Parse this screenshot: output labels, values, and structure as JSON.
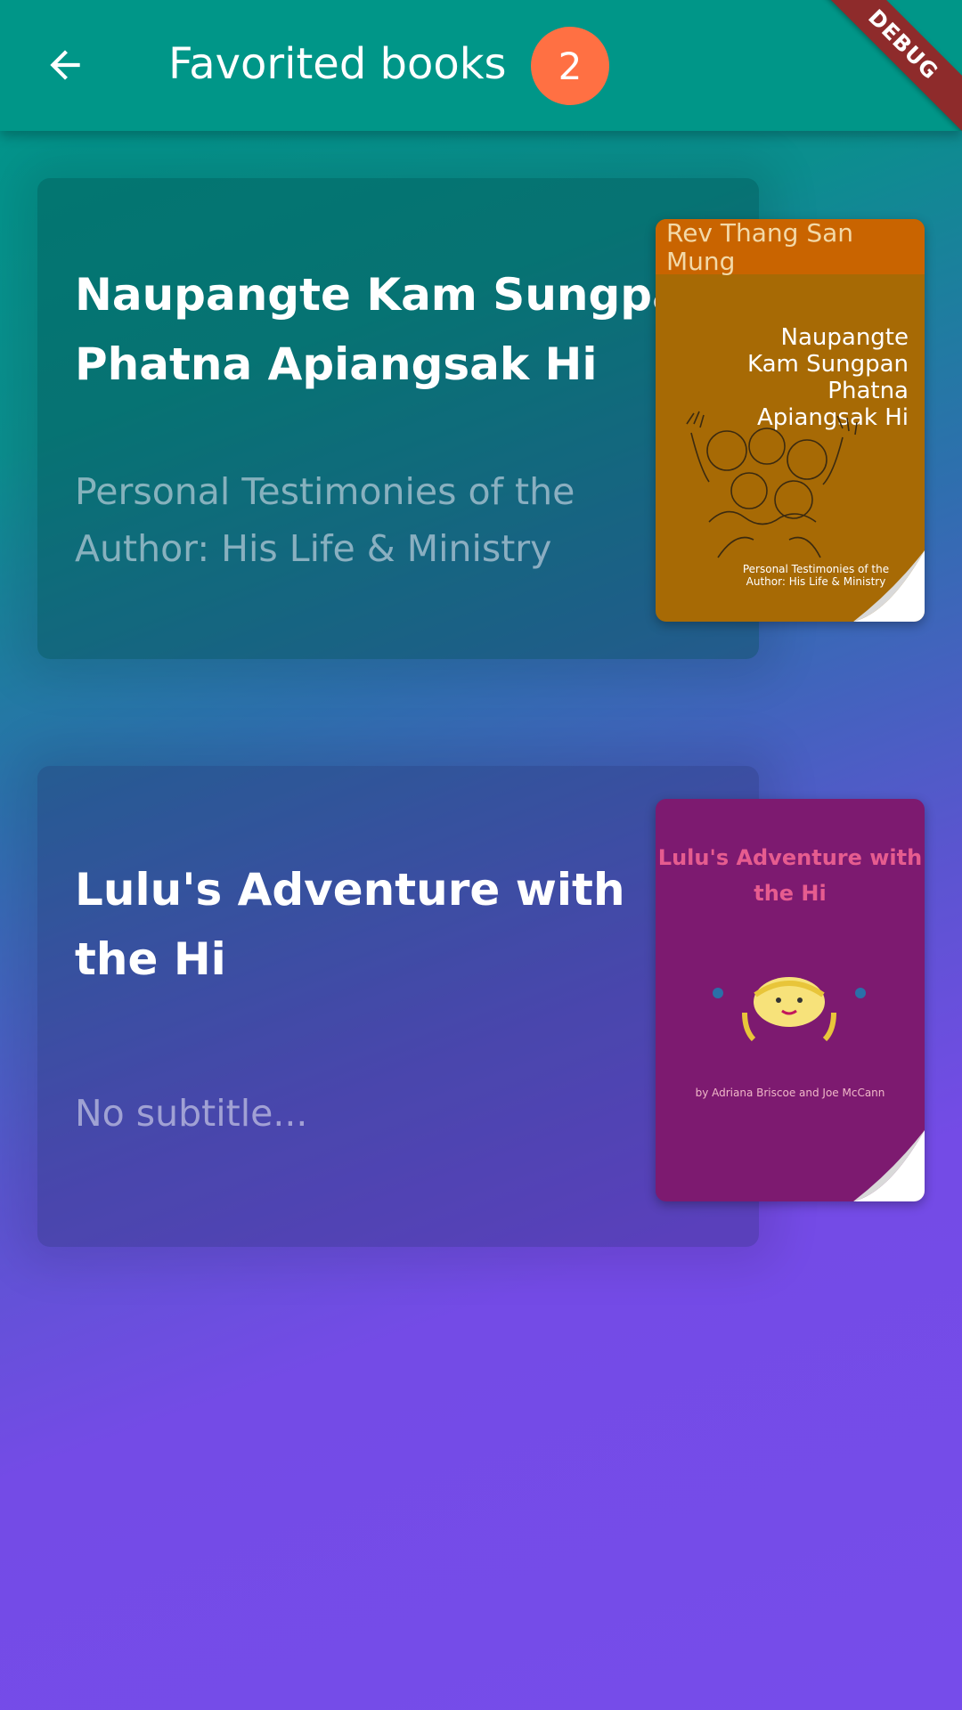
{
  "appbar": {
    "title": "Favorited books",
    "count": "2",
    "debug_label": "DEBUG",
    "back_icon": "arrow-back-icon"
  },
  "books": [
    {
      "title": "Naupangte Kam Sungpan Phatna Apiangsak Hi",
      "subtitle": "Personal Testimonies of the Author: His Life & Ministry",
      "cover": {
        "author": "Rev Thang San Mung",
        "title": "Naupangte Kam Sungpan Phatna Apiangsak Hi",
        "subtitle": "Personal Testimonies of the Author: His Life & Ministry",
        "color": "#A76A05"
      }
    },
    {
      "title": "Lulu's Adventure with the Hi",
      "subtitle": "No subtitle...",
      "cover": {
        "title": "Lulu's Adventure with the Hi",
        "credit": "by Adriana Briscoe and Joe McCann",
        "color": "#7D1A70"
      }
    }
  ],
  "colors": {
    "appbar": "#009688",
    "badge": "#FF7043",
    "background_top": "#00978A",
    "background_bottom": "#764CEA"
  }
}
